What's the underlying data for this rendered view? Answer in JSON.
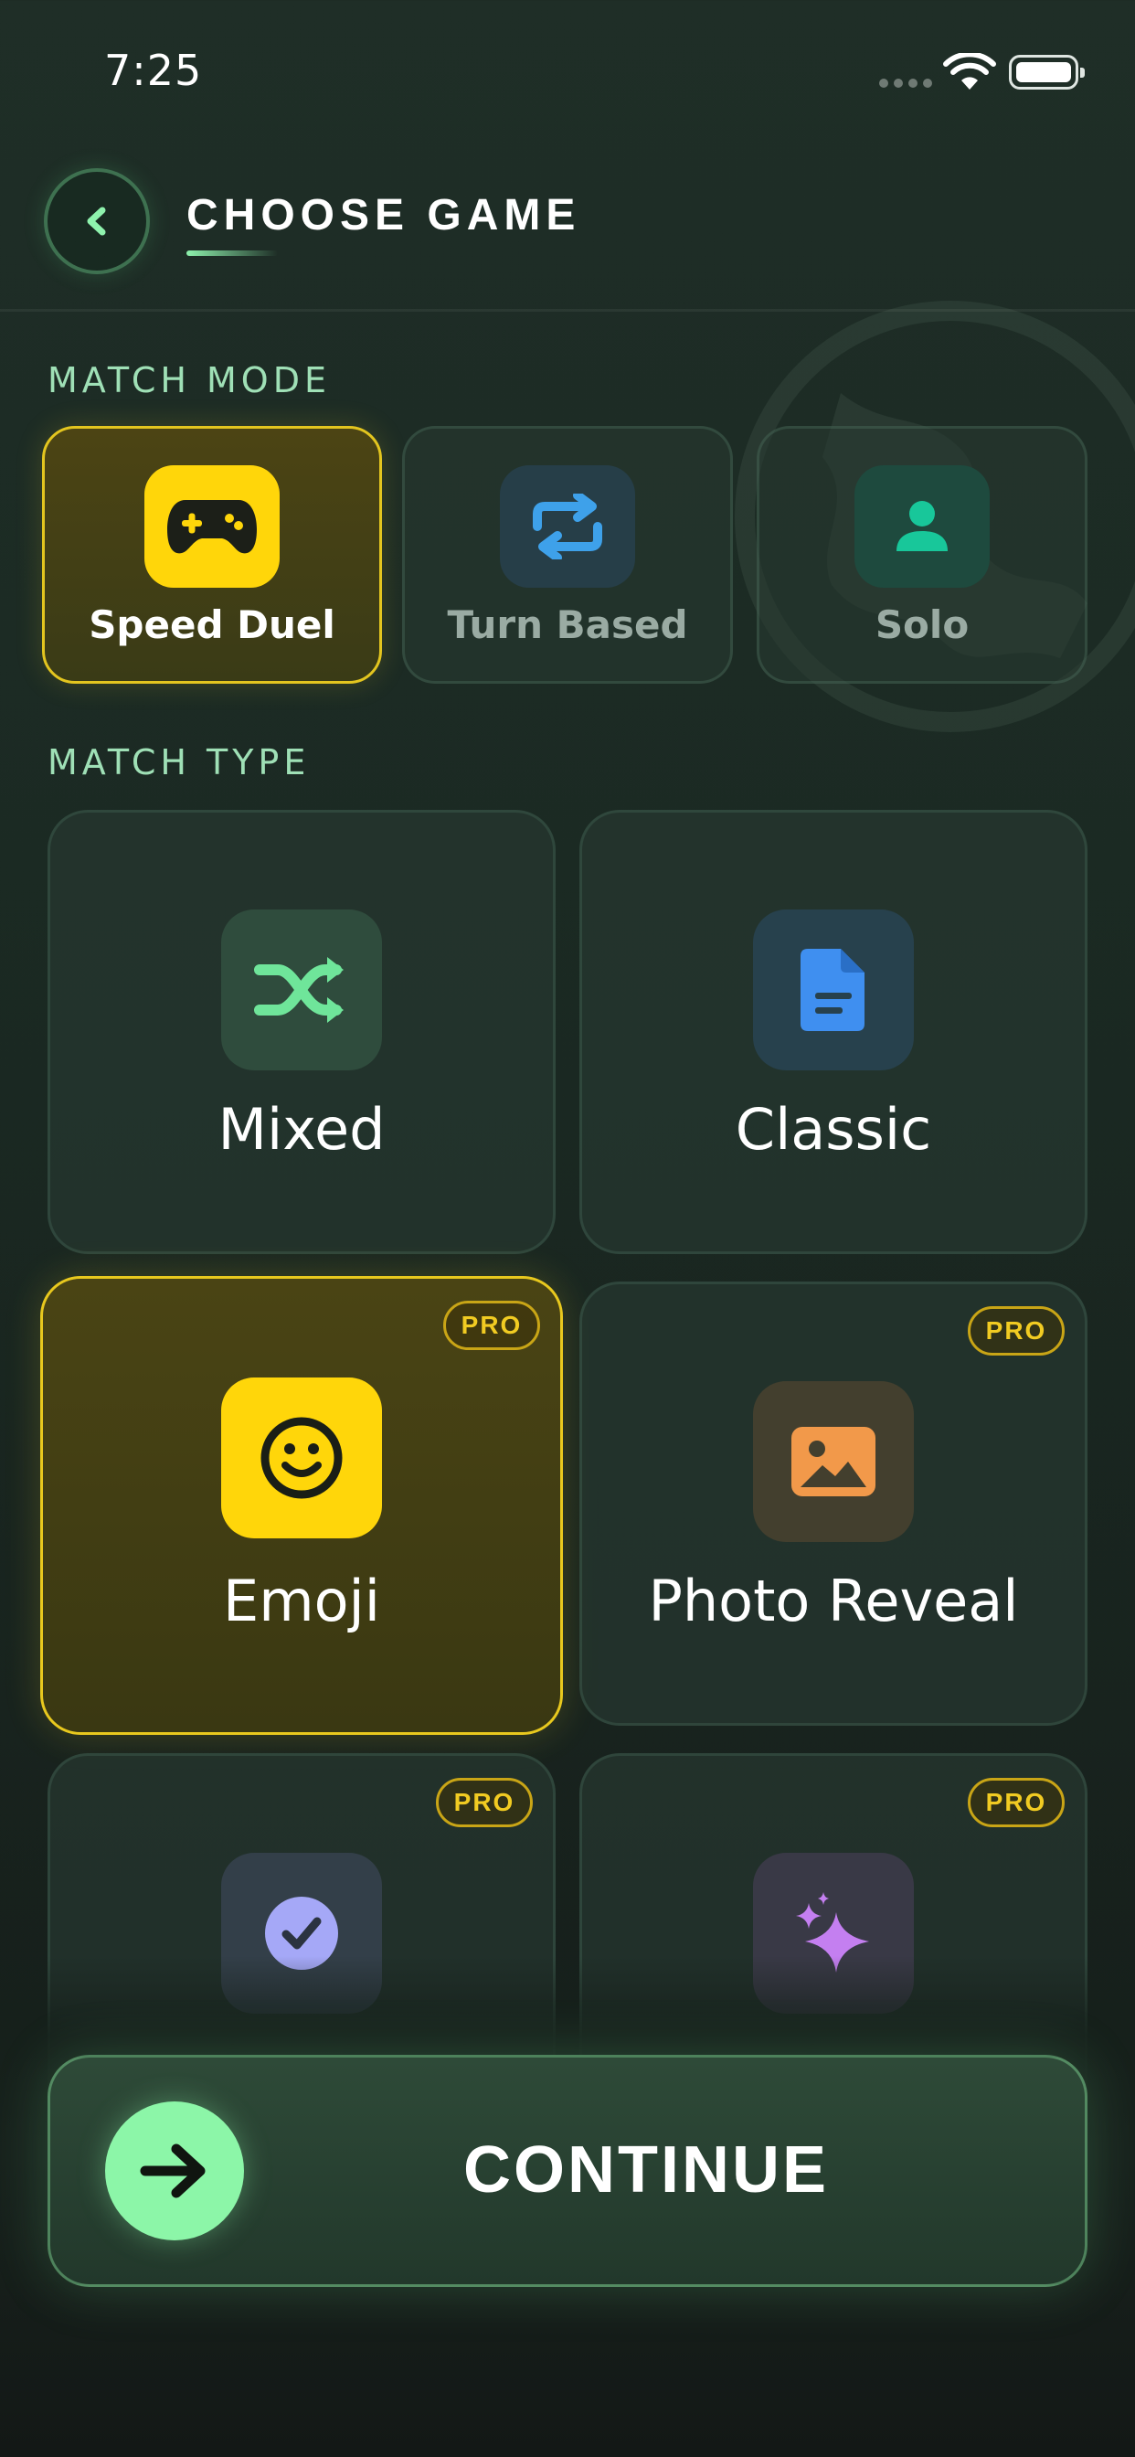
{
  "status_bar": {
    "time": "7:25"
  },
  "header": {
    "title": "CHOOSE GAME"
  },
  "match_mode": {
    "label": "MATCH MODE",
    "options": [
      {
        "label": "Speed Duel",
        "icon": "gamepad-icon",
        "selected": true
      },
      {
        "label": "Turn Based",
        "icon": "repeat-icon",
        "selected": false
      },
      {
        "label": "Solo",
        "icon": "user-icon",
        "selected": false
      }
    ]
  },
  "match_type": {
    "label": "MATCH TYPE",
    "options": [
      {
        "label": "Mixed",
        "icon": "shuffle-icon",
        "pro": false,
        "selected": false
      },
      {
        "label": "Classic",
        "icon": "document-icon",
        "pro": false,
        "selected": false
      },
      {
        "label": "Emoji",
        "icon": "smiley-icon",
        "pro": true,
        "selected": true
      },
      {
        "label": "Photo Reveal",
        "icon": "image-icon",
        "pro": true,
        "selected": false
      },
      {
        "label": "",
        "icon": "check-circle-icon",
        "pro": true,
        "selected": false
      },
      {
        "label": "",
        "icon": "sparkles-icon",
        "pro": true,
        "selected": false
      }
    ],
    "pro_badge": "PRO"
  },
  "continue_button": {
    "label": "CONTINUE"
  },
  "colors": {
    "accent_green": "#8cf6a8",
    "selected_yellow": "#ffd60a",
    "pro_gold": "#f1cb22",
    "background": "#1b2a23"
  }
}
